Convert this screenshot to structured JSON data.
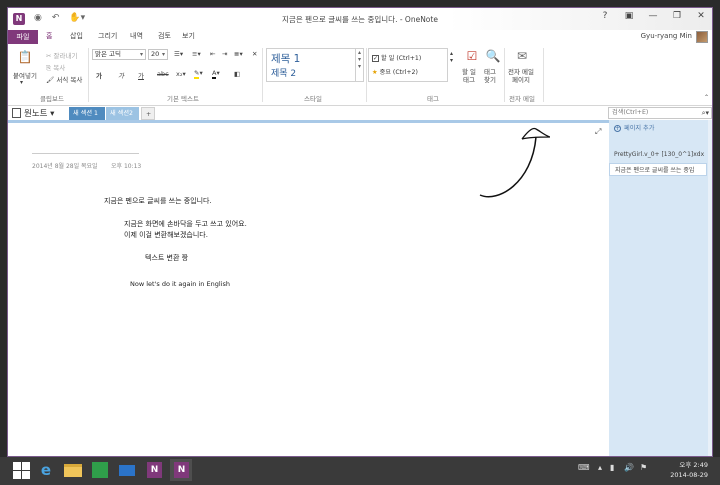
{
  "window": {
    "title": "지금은 펜으로 글씨를 쓰는 중입니다. - OneNote",
    "app_icon": "N",
    "controls": {
      "help": "?",
      "minimize": "—",
      "restore": "❐",
      "close": "✕"
    }
  },
  "ribbon_tabs": [
    "파일",
    "홈",
    "삽입",
    "그리기",
    "내역",
    "검토",
    "보기"
  ],
  "user": {
    "name": "Gyu-ryang Min"
  },
  "ribbon": {
    "clipboard": {
      "paste": "붙여넣기",
      "cut": "잘라내기",
      "copy": "복사",
      "format_painter": "서식 복사",
      "label": "클립보드"
    },
    "basic_text": {
      "font": "맑은 고딕",
      "size": "20",
      "bold": "가",
      "italic": "가",
      "underline": "가",
      "label": "기본 텍스트"
    },
    "styles": {
      "heading1": "제목 1",
      "heading2": "제목 2",
      "label": "스타일"
    },
    "tags": {
      "todo": "할 일 (Ctrl+1)",
      "important": "중요 (Ctrl+2)",
      "todo_tag": "할 일\n태그",
      "find_tags": "태그\n찾기",
      "label": "태그"
    },
    "email": {
      "email_page": "전자 메일\n페이지",
      "label": "전자 메일"
    }
  },
  "notebook": {
    "name": "원노트"
  },
  "sections": [
    {
      "label": "새 섹션 1"
    },
    {
      "label": "새 섹션2"
    }
  ],
  "add_section": "+",
  "search": {
    "placeholder": "검색(Ctrl+E)"
  },
  "page": {
    "date": "2014년 8월 28일 목요일",
    "time": "오후 10:13",
    "lines": [
      "지금은 펜으로 글씨를 쓰는 중입니다.",
      "지금은 화면에 손바닥을 두고 쓰고 있어요.",
      "이제 이걸 변환해보겠습니다.",
      "텍스트 변환 짱",
      "Now let's do it again in English"
    ]
  },
  "pages_pane": {
    "add_page": "페이지 추가",
    "items": [
      "PrettyGirl.v_0+ [130_0^1]xdx",
      "지금은 펜으로 글씨를 쓰는 중입"
    ]
  },
  "taskbar": {
    "clock_time": "오후 2:49",
    "clock_date": "2014-08-29"
  }
}
